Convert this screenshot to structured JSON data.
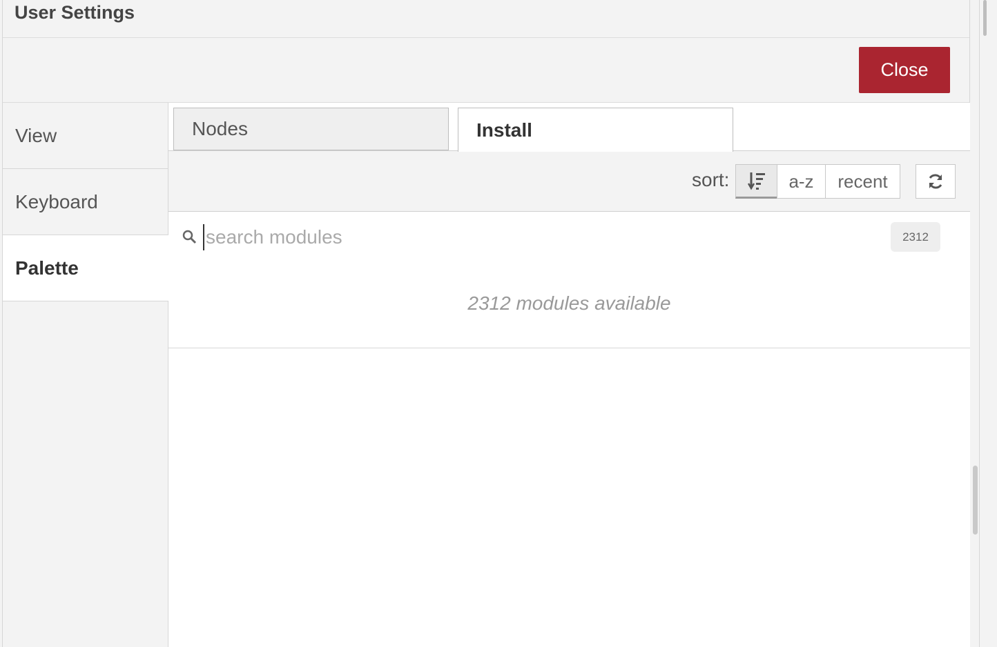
{
  "dialog": {
    "title": "User Settings",
    "close_label": "Close"
  },
  "sidebar": {
    "items": [
      {
        "label": "View",
        "active": false
      },
      {
        "label": "Keyboard",
        "active": false
      },
      {
        "label": "Palette",
        "active": true
      }
    ]
  },
  "tabs": [
    {
      "label": "Nodes",
      "active": false
    },
    {
      "label": "Install",
      "active": true
    }
  ],
  "sort": {
    "label": "sort:",
    "options": [
      {
        "label": "sort-relevance-icon",
        "icon": "sort-amount-down-icon",
        "active": true
      },
      {
        "label": "a-z",
        "active": false
      },
      {
        "label": "recent",
        "active": false
      }
    ],
    "refresh_icon": "refresh-icon"
  },
  "search": {
    "placeholder": "search modules",
    "value": "",
    "count": "2312"
  },
  "results": {
    "message": "2312 modules available"
  },
  "colors": {
    "accent": "#aa2530",
    "background": "#f3f3f3"
  }
}
